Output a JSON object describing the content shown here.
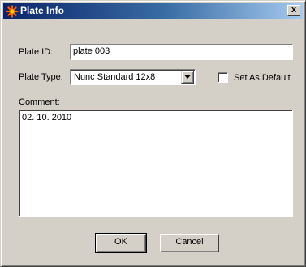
{
  "window": {
    "title": "Plate Info",
    "icon": "star-app-icon",
    "close_label": "x"
  },
  "plate_id": {
    "label": "Plate ID:",
    "value": "plate 003"
  },
  "plate_type": {
    "label": "Plate Type:",
    "selected": "Nunc Standard 12x8"
  },
  "set_default": {
    "label": "Set As Default",
    "checked": false
  },
  "comment": {
    "label": "Comment:",
    "value": "02. 10. 2010"
  },
  "buttons": {
    "ok": "OK",
    "cancel": "Cancel"
  },
  "colors": {
    "title_start": "#0a246a",
    "title_end": "#a6caf0",
    "face": "#d4d0c8"
  }
}
